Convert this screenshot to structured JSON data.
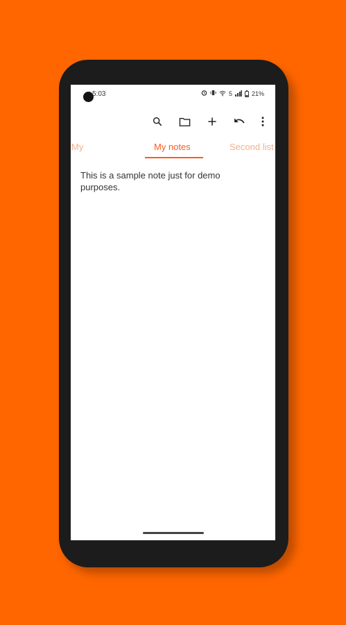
{
  "colors": {
    "background": "#ff6600",
    "accent": "#ff5a1a",
    "inactive_tab": "#f4b08a",
    "phone_frame": "#1c1c1c"
  },
  "status_bar": {
    "time": "5:03",
    "network": "5",
    "battery": "21%",
    "icons": [
      "alarm-icon",
      "vibrate-icon",
      "wifi-icon",
      "signal-icon",
      "battery-icon"
    ]
  },
  "toolbar": {
    "icons": [
      "search-icon",
      "folder-icon",
      "add-icon",
      "undo-icon",
      "more-vert-icon"
    ]
  },
  "tabs": [
    {
      "label": "My",
      "active": false
    },
    {
      "label": "My notes",
      "active": true
    },
    {
      "label": "Second list",
      "active": false
    }
  ],
  "note": {
    "text": "This is a sample note just for demo purposes."
  }
}
